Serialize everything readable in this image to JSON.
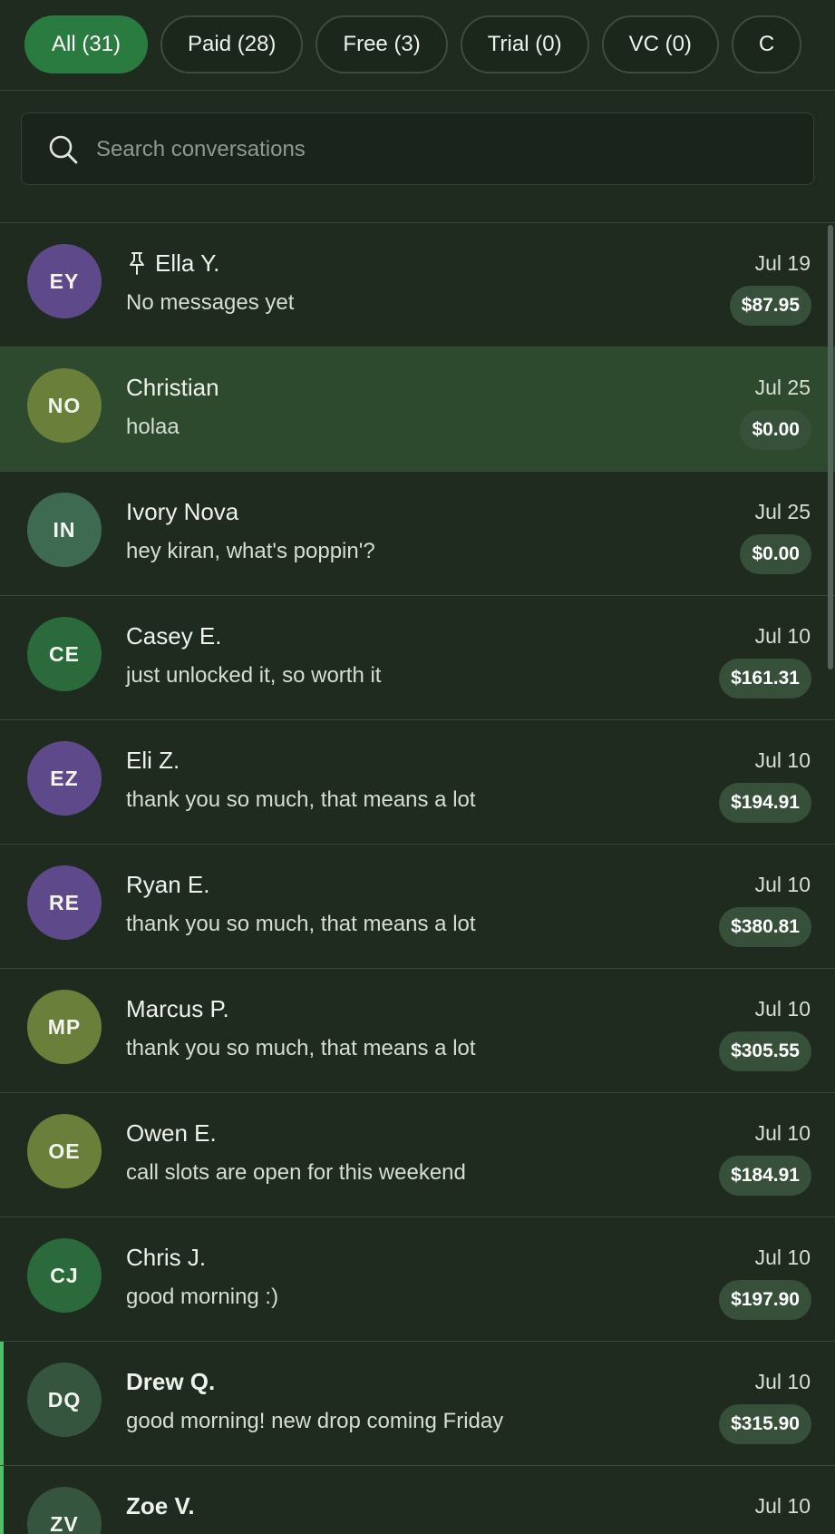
{
  "filters": [
    {
      "label": "All (31)",
      "active": true
    },
    {
      "label": "Paid (28)",
      "active": false
    },
    {
      "label": "Free (3)",
      "active": false
    },
    {
      "label": "Trial (0)",
      "active": false
    },
    {
      "label": "VC (0)",
      "active": false
    },
    {
      "label": "C",
      "active": false
    }
  ],
  "search": {
    "placeholder": "Search conversations",
    "value": "",
    "icon": "search-icon"
  },
  "colors": {
    "background": "#1f2b1f",
    "accent": "#2a7b3f",
    "selected_row": "#2d4a2f",
    "badge": "#36503a",
    "unread_marker": "#4fbf6a"
  },
  "conversations": [
    {
      "initials": "EY",
      "avatar_color": "#5e4a8a",
      "name": "Ella Y.",
      "pinned": true,
      "bold": false,
      "preview": "No messages yet",
      "date": "Jul 19",
      "amount": "$87.95",
      "selected": false,
      "marker": false
    },
    {
      "initials": "NO",
      "avatar_color": "#6a7f3a",
      "name": "Christian",
      "pinned": false,
      "bold": false,
      "preview": "holaa",
      "date": "Jul 25",
      "amount": "$0.00",
      "selected": true,
      "marker": false
    },
    {
      "initials": "IN",
      "avatar_color": "#3f6a52",
      "name": "Ivory Nova",
      "pinned": false,
      "bold": false,
      "preview": "hey kiran, what's poppin'?",
      "date": "Jul 25",
      "amount": "$0.00",
      "selected": false,
      "marker": false
    },
    {
      "initials": "CE",
      "avatar_color": "#2b6a3a",
      "name": "Casey E.",
      "pinned": false,
      "bold": false,
      "preview": "just unlocked it, so worth it",
      "date": "Jul 10",
      "amount": "$161.31",
      "selected": false,
      "marker": false
    },
    {
      "initials": "EZ",
      "avatar_color": "#5e4a8a",
      "name": "Eli Z.",
      "pinned": false,
      "bold": false,
      "preview": "thank you so much, that means a lot",
      "date": "Jul 10",
      "amount": "$194.91",
      "selected": false,
      "marker": false
    },
    {
      "initials": "RE",
      "avatar_color": "#5e4a8a",
      "name": "Ryan E.",
      "pinned": false,
      "bold": false,
      "preview": "thank you so much, that means a lot",
      "date": "Jul 10",
      "amount": "$380.81",
      "selected": false,
      "marker": false
    },
    {
      "initials": "MP",
      "avatar_color": "#6a7f3a",
      "name": "Marcus P.",
      "pinned": false,
      "bold": false,
      "preview": "thank you so much, that means a lot",
      "date": "Jul 10",
      "amount": "$305.55",
      "selected": false,
      "marker": false
    },
    {
      "initials": "OE",
      "avatar_color": "#6a7f3a",
      "name": "Owen E.",
      "pinned": false,
      "bold": false,
      "preview": "call slots are open for this weekend",
      "date": "Jul 10",
      "amount": "$184.91",
      "selected": false,
      "marker": false
    },
    {
      "initials": "CJ",
      "avatar_color": "#2b6a3a",
      "name": "Chris J.",
      "pinned": false,
      "bold": false,
      "preview": "good morning :)",
      "date": "Jul 10",
      "amount": "$197.90",
      "selected": false,
      "marker": false
    },
    {
      "initials": "DQ",
      "avatar_color": "#35553f",
      "name": "Drew Q.",
      "pinned": false,
      "bold": true,
      "preview": "good morning! new drop coming Friday",
      "date": "Jul 10",
      "amount": "$315.90",
      "selected": false,
      "marker": true
    },
    {
      "initials": "ZV",
      "avatar_color": "#35553f",
      "name": "Zoe V.",
      "pinned": false,
      "bold": true,
      "preview": "",
      "date": "Jul 10",
      "amount": "",
      "selected": false,
      "marker": true
    }
  ]
}
